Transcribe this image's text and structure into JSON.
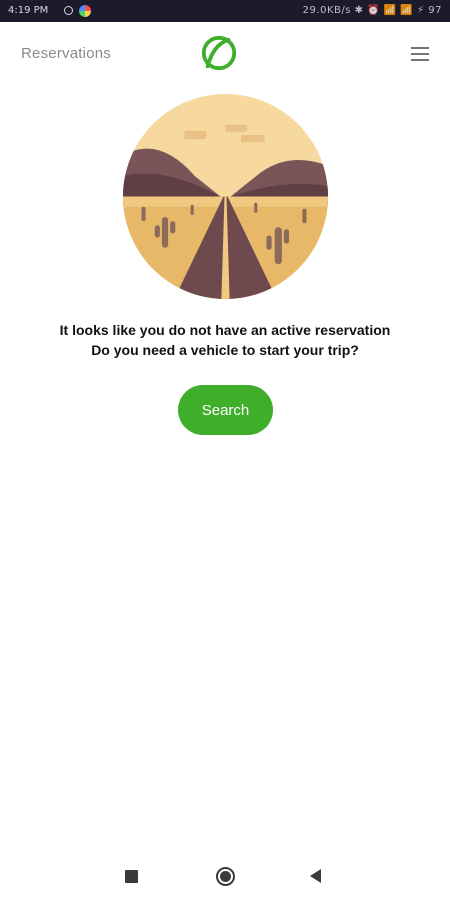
{
  "status_bar": {
    "time": "4:19 PM",
    "right_text": "29.0KB/s ✱ ⏰ 📶 📶 ⚡ 97"
  },
  "app_bar": {
    "title": "Reservations",
    "logo_icon": "leaf-logo-icon",
    "menu_icon": "hamburger-menu-icon"
  },
  "empty_state": {
    "illustration_icon": "desert-road-illustration",
    "line1": "It looks like you do not have an active reservation",
    "line2": "Do you need a vehicle to start your trip?",
    "search_label": "Search"
  },
  "nav_bar": {
    "recents_icon": "square-recents-icon",
    "home_icon": "circle-home-icon",
    "back_icon": "triangle-back-icon"
  },
  "colors": {
    "accent": "#3fae2a",
    "title_gray": "#8b8b8b",
    "sky": "#f7d9a0",
    "mountain": "#6e4a4e",
    "sand": "#e7b868"
  }
}
